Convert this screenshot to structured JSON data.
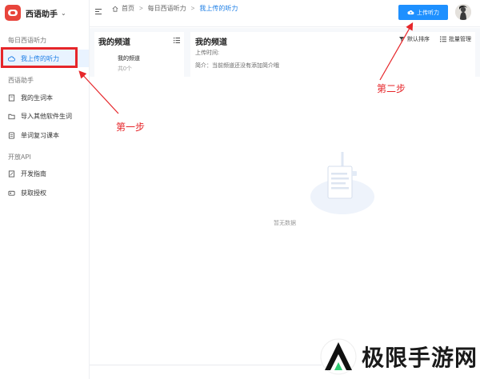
{
  "app": {
    "name": "西语助手"
  },
  "sidebar": {
    "sections": [
      {
        "title": "每日西语听力",
        "items": [
          {
            "label": "我上传的听力",
            "icon": "cloud-icon",
            "active": true
          }
        ]
      },
      {
        "title": "西语助手",
        "items": [
          {
            "label": "我的生词本",
            "icon": "notebook-icon"
          },
          {
            "label": "导入其他软件生词",
            "icon": "folder-icon"
          },
          {
            "label": "单词复习课本",
            "icon": "book-icon"
          }
        ]
      },
      {
        "title": "开放API",
        "items": [
          {
            "label": "开发指南",
            "icon": "edit-icon"
          },
          {
            "label": "获取授权",
            "icon": "key-icon"
          }
        ]
      }
    ]
  },
  "topbar": {
    "breadcrumb": [
      "首页",
      "每日西语听力",
      "我上传的听力"
    ],
    "upload_label": "上传听力"
  },
  "channels": {
    "title": "我的频道",
    "item_name": "我的频道",
    "item_count": "共0个"
  },
  "detail": {
    "title": "我的频道",
    "time_label": "上传时间:",
    "intro_label": "简介：当前频道还没有添加简介哦",
    "sort_label": "默认排序",
    "batch_label": "批量管理"
  },
  "empty": {
    "text": "暂无数据"
  },
  "annotations": {
    "step1": "第一步",
    "step2": "第二步"
  },
  "watermark": {
    "text": "极限手游网"
  },
  "colors": {
    "accent": "#1e90ff",
    "highlight": "#e6262a",
    "active_bg": "#e9f3ff"
  }
}
